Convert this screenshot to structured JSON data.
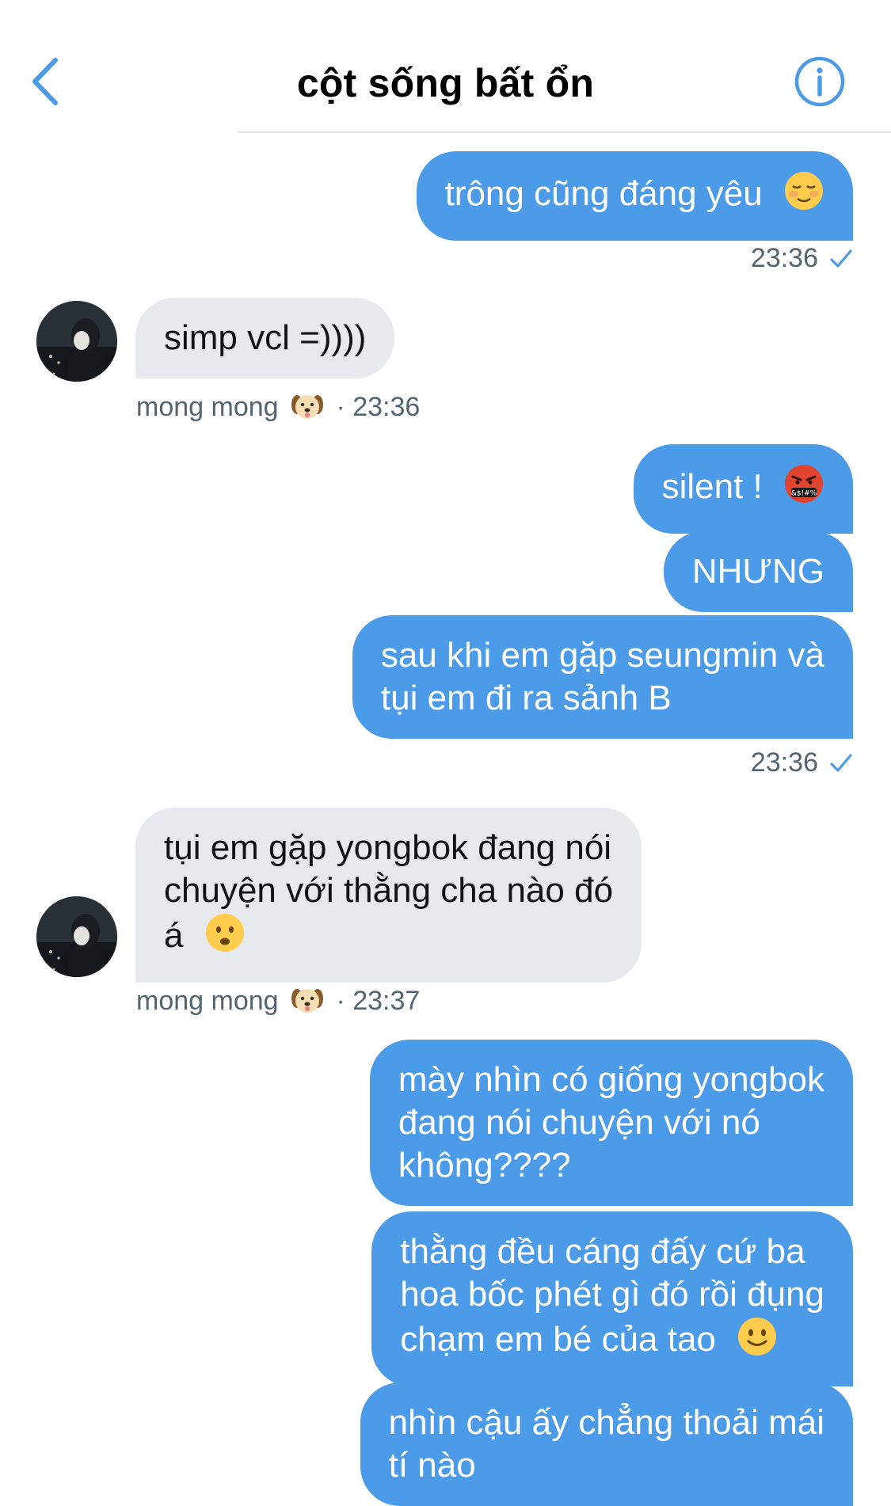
{
  "header": {
    "title": "cột sống bất ổn",
    "back_icon": "chevron-left-icon",
    "info_icon": "info-circle-icon",
    "accent_color": "#4c9be8"
  },
  "messages": [
    {
      "direction": "out",
      "text": "trông cũng đáng yêu",
      "emoji": "relieved-blush-emoji"
    },
    {
      "direction": "out",
      "time": "23:36",
      "status_icon": "check-icon"
    },
    {
      "direction": "in",
      "text": "simp vcl =))))"
    },
    {
      "direction": "in",
      "sender": "mong mong",
      "sender_emoji": "dog-face-emoji",
      "time": "· 23:36"
    },
    {
      "direction": "out",
      "text": "silent !",
      "emoji": "cursing-face-emoji",
      "emoji_text": "&$!#%"
    },
    {
      "direction": "out",
      "text": "NHƯNG"
    },
    {
      "direction": "out",
      "lines": [
        "sau khi em gặp seungmin và",
        "tụi em đi ra sảnh B"
      ]
    },
    {
      "direction": "out",
      "time": "23:36",
      "status_icon": "check-icon"
    },
    {
      "direction": "in",
      "lines": [
        "tụi em gặp yongbok đang nói",
        "chuyện với thằng cha nào đó",
        "á"
      ],
      "emoji": "frowning-face-emoji"
    },
    {
      "direction": "in",
      "sender": "mong mong",
      "sender_emoji": "dog-face-emoji",
      "time": "· 23:37"
    },
    {
      "direction": "out",
      "lines": [
        "mày nhìn có giống yongbok",
        "đang nói chuyện với nó",
        "không????"
      ]
    },
    {
      "direction": "out",
      "lines": [
        "thằng đều cáng đấy cứ ba",
        "hoa bốc phét gì đó rồi đụng",
        "chạm em bé của tao"
      ],
      "emoji": "slightly-smiling-emoji"
    },
    {
      "direction": "out",
      "lines": [
        "nhìn cậu ấy chẳng thoải mái",
        "tí nào"
      ]
    }
  ]
}
